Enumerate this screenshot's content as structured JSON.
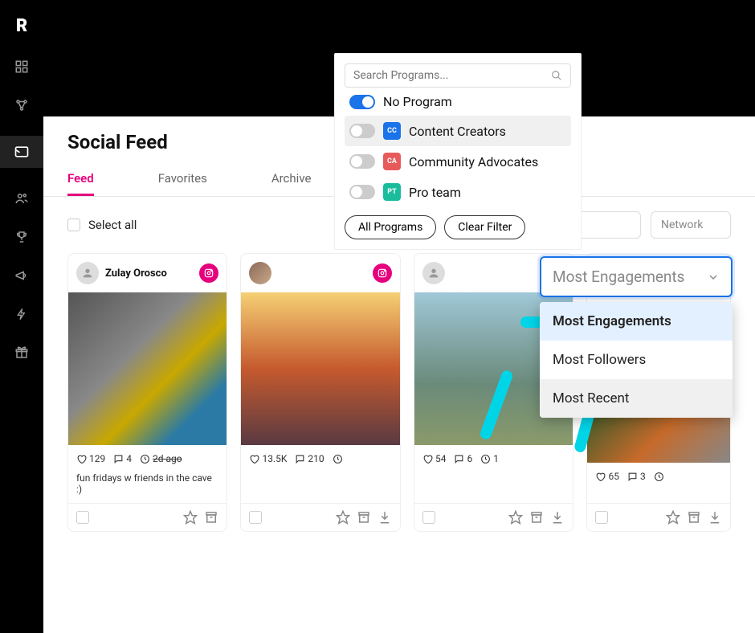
{
  "page_title": "Social Feed",
  "tabs": [
    "Feed",
    "Favorites",
    "Archive"
  ],
  "active_tab": 0,
  "select_all_label": "Select all",
  "network_dropdown": {
    "placeholder": "Network"
  },
  "programs_popover": {
    "search_placeholder": "Search Programs...",
    "no_program_label": "No Program",
    "no_program_on": true,
    "items": [
      {
        "badge": "CC",
        "label": "Content Creators",
        "on": false,
        "hover": true
      },
      {
        "badge": "CA",
        "label": "Community Advocates",
        "on": false,
        "hover": false
      },
      {
        "badge": "PT",
        "label": "Pro team",
        "on": false,
        "hover": false
      }
    ],
    "all_btn": "All Programs",
    "clear_btn": "Clear Filter"
  },
  "sort": {
    "label": "Most Engagements",
    "options": [
      "Most Engagements",
      "Most Followers",
      "Most Recent"
    ],
    "selected": 0
  },
  "cards": [
    {
      "author": "Zulay Orosco",
      "likes": "129",
      "comments": "4",
      "time": "2d ago",
      "caption": "fun fridays w friends in the cave :)"
    },
    {
      "author": "",
      "likes": "13.5K",
      "comments": "210",
      "time": "",
      "caption": ""
    },
    {
      "author": "",
      "likes": "54",
      "comments": "6",
      "time": "1",
      "caption": ""
    },
    {
      "author": "",
      "likes": "65",
      "comments": "3",
      "time": "",
      "caption": ""
    }
  ]
}
